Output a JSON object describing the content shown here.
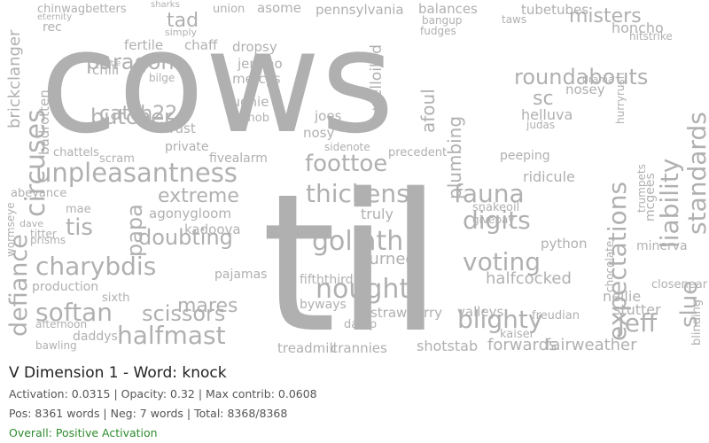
{
  "wordcloud": {
    "text_color": "#b0b0b0",
    "words": [
      "cows",
      "til",
      "unpleasantness",
      "defiance",
      "circuses",
      "charybdis",
      "softan",
      "halfmast",
      "nought",
      "goliath",
      "thickens",
      "foottoe",
      "fauna",
      "voting",
      "digits",
      "blighty",
      "expectations",
      "jeff",
      "standards",
      "liability",
      "slue",
      "roundabouts",
      "misters",
      "paragon",
      "butcher",
      "catch22",
      "papa",
      "tis",
      "doubting",
      "extreme",
      "scissors",
      "mares",
      "plumbing",
      "durned",
      "fifththird",
      "halfcocked",
      "ridicule",
      "forwards",
      "fairweather",
      "treadmill",
      "crannies",
      "shotstab",
      "daddys",
      "production",
      "chinwagbetters",
      "brickclanger",
      "badrotten",
      "tad",
      "fertile",
      "chaff",
      "dropsy",
      "jericho",
      "mercys",
      "hughie",
      "helluva",
      "honcho",
      "asome",
      "pennsylvania",
      "balances",
      "tubetubes",
      "union",
      "sharks",
      "chili",
      "private",
      "fivealarm",
      "agonygloom",
      "kadoova",
      "pajamas",
      "sixth",
      "python",
      "nellie",
      "stutter",
      "truly",
      "strawberry",
      "valleys",
      "afoul",
      "welloiled",
      "joes",
      "nosy",
      "peeping",
      "knob",
      "thrust",
      "scram",
      "mae",
      "prisms",
      "titter",
      "dave",
      "abeyance",
      "afternoon",
      "bawling",
      "byways",
      "damp",
      "kaiser",
      "freudian",
      "nosey",
      "judas",
      "rec",
      "chattels",
      "wormseye",
      "minerva",
      "blinding",
      "closenear",
      "mcgees",
      "trumpets",
      "chocolate",
      "sidenote",
      "hitstrike",
      "precedent",
      "snakeoil",
      "givepay",
      "hurryrush",
      "drama",
      "fudges",
      "taws",
      "bangup",
      "eternity",
      "simply",
      "bilge",
      "hattie",
      "sc"
    ]
  },
  "caption": {
    "title": "V Dimension 1 - Word: knock",
    "metrics": "Activation: 0.0315 | Opacity: 0.32 | Max contrib: 0.0608",
    "counts": "Pos: 8361 words | Neg: 7 words | Total: 8368/8368",
    "verdict": "Overall: Positive Activation",
    "verdict_color": "#2e8b2e"
  }
}
